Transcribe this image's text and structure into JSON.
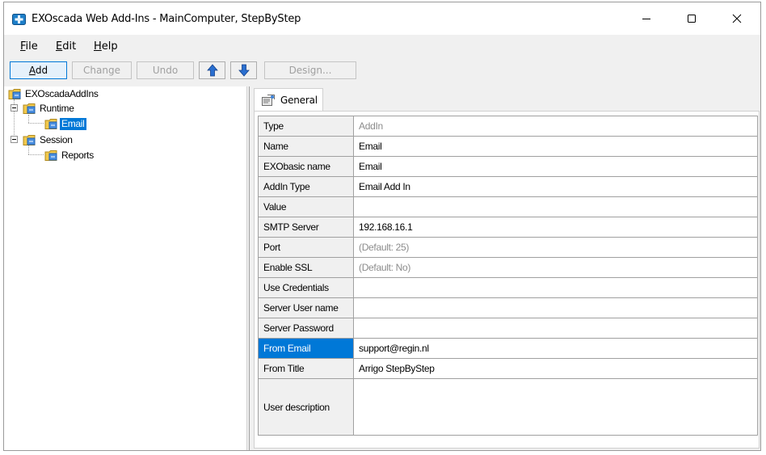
{
  "window": {
    "title": "EXOscada Web Add-Ins - MainComputer, StepByStep"
  },
  "menu": {
    "file": {
      "mnemonic": "F",
      "rest": "ile"
    },
    "edit": {
      "mnemonic": "E",
      "rest": "dit"
    },
    "help": {
      "mnemonic": "H",
      "rest": "elp"
    }
  },
  "toolbar": {
    "add": {
      "mnemonic": "A",
      "rest": "dd"
    },
    "change": "Change",
    "undo": "Undo",
    "design": "Design..."
  },
  "tree": {
    "root": "EXOscadaAddIns",
    "runtime": "Runtime",
    "email": "Email",
    "session": "Session",
    "reports": "Reports"
  },
  "tabs": {
    "general": "General"
  },
  "properties": [
    {
      "name": "Type",
      "value": "AddIn",
      "dim": true
    },
    {
      "name": "Name",
      "value": "Email",
      "dim": false
    },
    {
      "name": "EXObasic name",
      "value": "Email",
      "dim": false
    },
    {
      "name": "AddIn Type",
      "value": "Email Add In",
      "dim": false
    },
    {
      "name": "Value",
      "value": "",
      "dim": false
    },
    {
      "name": "SMTP Server",
      "value": "192.168.16.1",
      "dim": false
    },
    {
      "name": "Port",
      "value": "(Default: 25)",
      "dim": true
    },
    {
      "name": "Enable SSL",
      "value": "(Default: No)",
      "dim": true
    },
    {
      "name": "Use Credentials",
      "value": "",
      "dim": false
    },
    {
      "name": "Server User name",
      "value": "",
      "dim": false
    },
    {
      "name": "Server Password",
      "value": "",
      "dim": false
    },
    {
      "name": "From Email",
      "value": "support@regin.nl",
      "dim": false,
      "selected": true
    },
    {
      "name": "From Title",
      "value": "Arrigo StepByStep",
      "dim": false
    },
    {
      "name": "User description",
      "value": "",
      "dim": false,
      "tall": true
    }
  ]
}
